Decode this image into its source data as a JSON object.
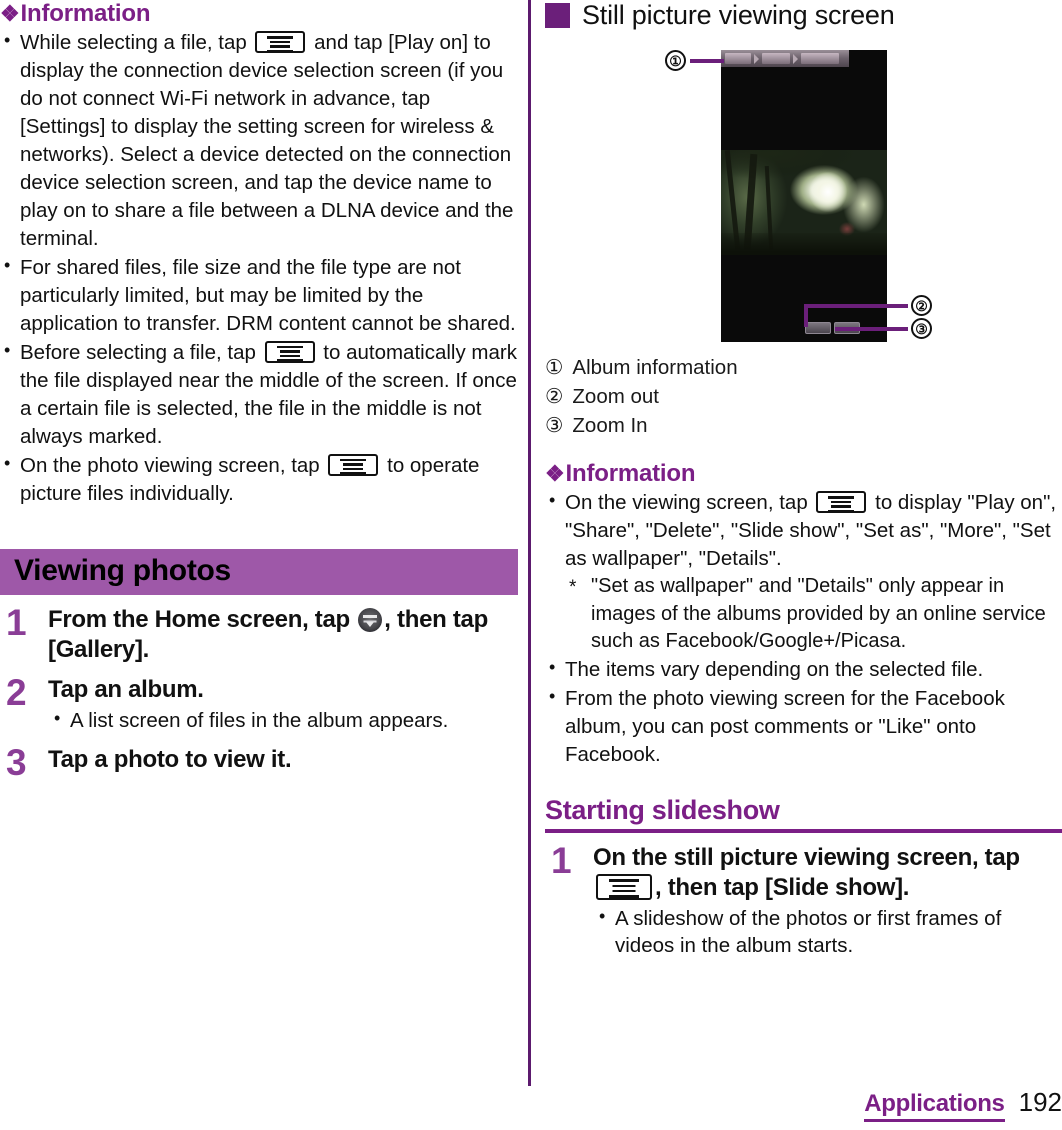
{
  "left_column": {
    "info_heading": {
      "diamond": "❖",
      "label": "Information"
    },
    "info_bullets": [
      {
        "parts": [
          {
            "type": "text",
            "value": "While selecting a file, tap "
          },
          {
            "type": "icon",
            "value": "menu-key-icon"
          },
          {
            "type": "text",
            "value": " and tap [Play on] to display the connection device selection screen (if you do not connect Wi-Fi network in advance, tap [Settings] to display the setting screen for wireless & networks). Select a device detected on the connection device selection screen, and tap the device name to play on to share a file between a DLNA device and the terminal."
          }
        ]
      },
      {
        "parts": [
          {
            "type": "text",
            "value": "For shared files, file size and the file type are not particularly limited, but may be limited by the application to transfer. DRM content cannot be shared."
          }
        ]
      },
      {
        "parts": [
          {
            "type": "text",
            "value": "Before selecting a file, tap "
          },
          {
            "type": "icon",
            "value": "menu-key-icon"
          },
          {
            "type": "text",
            "value": " to automatically mark the file displayed near the middle of the screen. If once a certain file is selected, the file in the middle is not always marked."
          }
        ]
      },
      {
        "parts": [
          {
            "type": "text",
            "value": "On the photo viewing screen, tap "
          },
          {
            "type": "icon",
            "value": "menu-key-icon"
          },
          {
            "type": "text",
            "value": " to operate picture files individually."
          }
        ]
      }
    ],
    "section_bar_title": "Viewing photos",
    "steps": [
      {
        "number": "1",
        "title_before": "From the Home screen, tap ",
        "title_icon": "app-drawer-icon",
        "title_after": ", then tap [Gallery].",
        "subs": []
      },
      {
        "number": "2",
        "title_before": "Tap an album.",
        "title_icon": "",
        "title_after": "",
        "subs": [
          "A list screen of files in the album appears."
        ]
      },
      {
        "number": "3",
        "title_before": "Tap a photo to view it.",
        "title_icon": "",
        "title_after": "",
        "subs": []
      }
    ]
  },
  "right_column": {
    "figure_heading": "Still picture viewing screen",
    "figure": {
      "callouts": [
        {
          "number": "①",
          "target": "album-information-bar"
        },
        {
          "number": "②",
          "target": "zoom-out-button"
        },
        {
          "number": "③",
          "target": "zoom-in-button"
        }
      ]
    },
    "legend": [
      {
        "number": "①",
        "label": "Album information"
      },
      {
        "number": "②",
        "label": "Zoom out"
      },
      {
        "number": "③",
        "label": "Zoom In"
      }
    ],
    "info_heading": {
      "diamond": "❖",
      "label": "Information"
    },
    "info_bullets": [
      {
        "parts": [
          {
            "type": "text",
            "value": "On the viewing screen, tap "
          },
          {
            "type": "icon",
            "value": "menu-key-icon"
          },
          {
            "type": "text",
            "value": " to display \"Play on\", \"Share\", \"Delete\", \"Slide show\", \"Set as\", \"More\", \"Set as wallpaper\", \"Details\"."
          }
        ],
        "note": "\"Set as wallpaper\" and \"Details\" only appear in images of the albums provided by an online service such as Facebook/Google+/Picasa."
      },
      {
        "parts": [
          {
            "type": "text",
            "value": "The items vary depending on the selected file."
          }
        ]
      },
      {
        "parts": [
          {
            "type": "text",
            "value": "From the photo viewing screen for the Facebook album, you can post comments or \"Like\" onto Facebook."
          }
        ]
      }
    ],
    "section_heading": "Starting slideshow",
    "steps": [
      {
        "number": "1",
        "title_before": "On the still picture viewing screen, tap ",
        "title_icon": "menu-key-icon",
        "title_after": ", then tap [Slide show].",
        "subs": [
          "A slideshow of the photos or first frames of videos in the album starts."
        ]
      }
    ]
  },
  "footer": {
    "section": "Applications",
    "page": "192"
  },
  "colors": {
    "heading_purple": "#7b1f86",
    "bar_purple": "#9e58a8",
    "divider_purple": "#5c1a6e",
    "step_number_purple": "#8a3d96",
    "square_mark": "#6b1f7a"
  }
}
